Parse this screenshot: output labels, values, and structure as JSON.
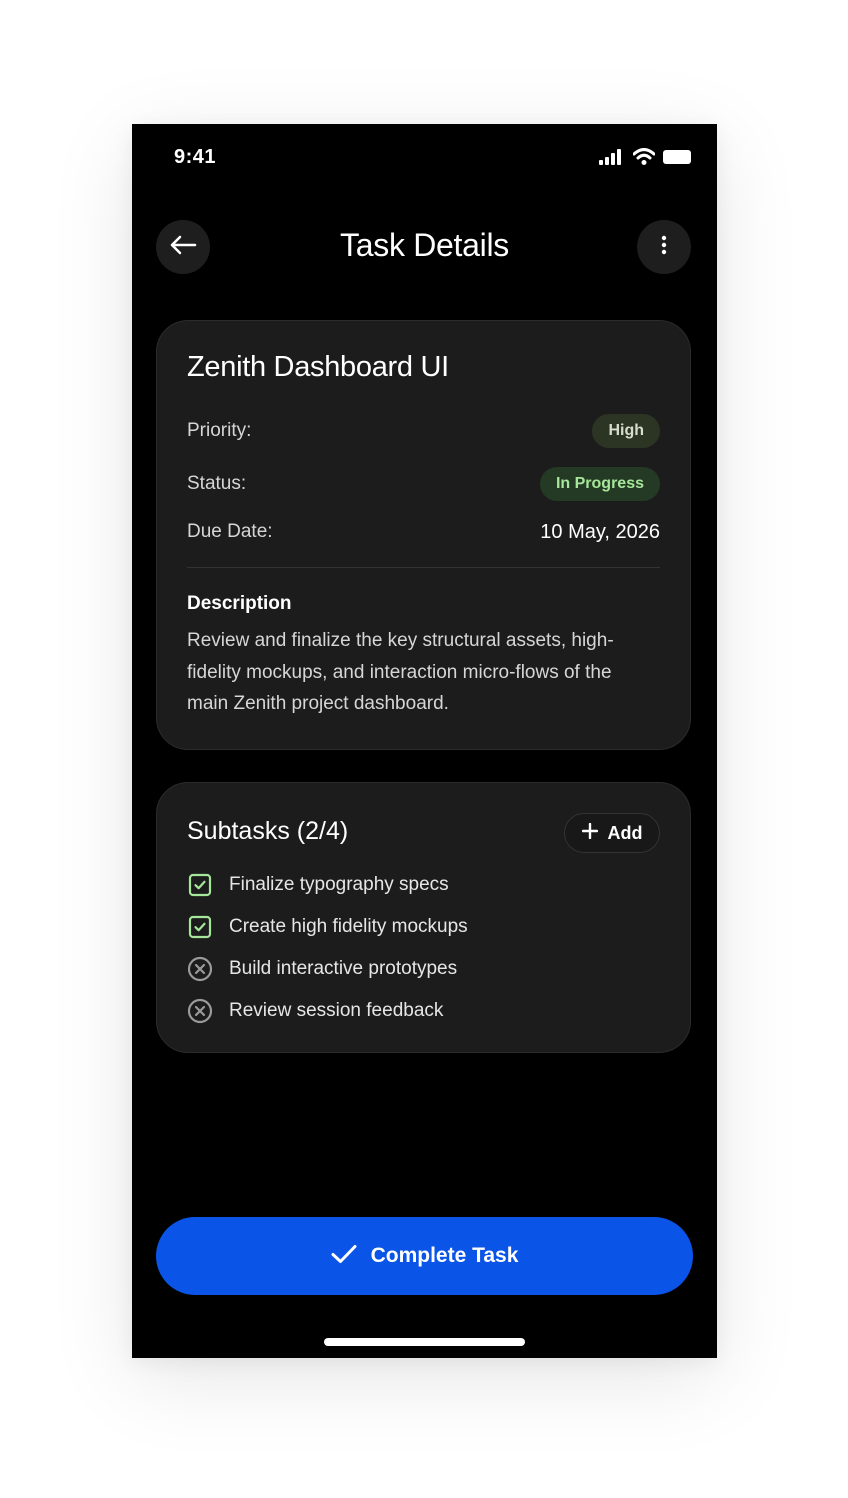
{
  "status_bar": {
    "time": "9:41",
    "icons": [
      "signal-icon",
      "wifi-icon",
      "battery-icon"
    ]
  },
  "header": {
    "title": "Task Details",
    "back_icon": "arrow-left-icon",
    "more_icon": "more-vertical-icon"
  },
  "task": {
    "name": "Zenith Dashboard UI",
    "priority_label": "Priority:",
    "priority_value": "High",
    "status_label": "Status:",
    "status_value": "In Progress",
    "due_label": "Due Date:",
    "due_value": "10 May, 2026",
    "description_title": "Description",
    "description": "Review and finalize the key structural assets, high-fidelity mockups, and interaction micro-flows of the main Zenith project dashboard."
  },
  "subtasks": {
    "title": "Subtasks (2/4)",
    "add_label": "Add",
    "items": [
      {
        "label": "Finalize typography specs",
        "done": true
      },
      {
        "label": "Create high fidelity mockups",
        "done": true
      },
      {
        "label": "Build interactive prototypes",
        "done": false
      },
      {
        "label": "Review session feedback",
        "done": false
      }
    ]
  },
  "actions": {
    "complete_label": "Complete Task"
  },
  "colors": {
    "accent": "#0a54e8",
    "done": "#a6e69a",
    "pending": "#9a9a9a",
    "background": "#000000",
    "card": "#1c1c1c"
  }
}
